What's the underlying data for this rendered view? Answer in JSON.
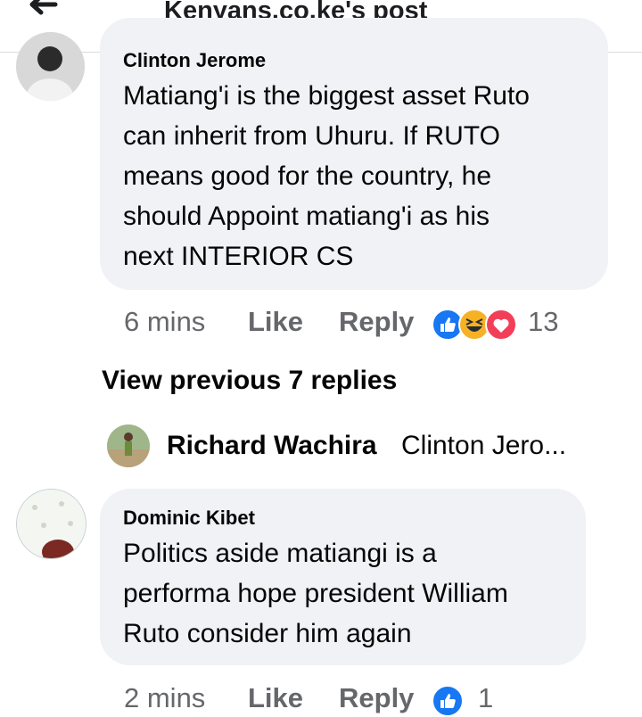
{
  "header": {
    "title": "Kenyans.co.ke's post"
  },
  "comments": [
    {
      "author": "Clinton Jerome",
      "lines": [
        "Matiang'i is the biggest asset Ruto",
        "can inherit from Uhuru. If RUTO",
        "means good for the country, he",
        "should Appoint matiang'i as his",
        "next INTERIOR CS"
      ],
      "time": "6 mins",
      "like": "Like",
      "reply": "Reply",
      "reaction_count": "13",
      "reactions": [
        "like-icon",
        "haha-icon",
        "love-icon"
      ]
    },
    {
      "author": "Dominic Kibet",
      "lines": [
        "Politics aside matiangi is a",
        "performa hope president William",
        "Ruto consider him again"
      ],
      "time": "2 mins",
      "like": "Like",
      "reply": "Reply",
      "reaction_count": "1",
      "reactions": [
        "like-icon"
      ]
    }
  ],
  "view_previous": "View previous 7 replies",
  "latest_reply": {
    "author": "Richard Wachira",
    "snippet": "Clinton Jero..."
  },
  "colors": {
    "like_blue": "#1877f2",
    "love_red": "#f33e58",
    "haha_yellow": "#f7b125",
    "bubble_bg": "#f0f2f5",
    "meta_gray": "#65676b"
  }
}
